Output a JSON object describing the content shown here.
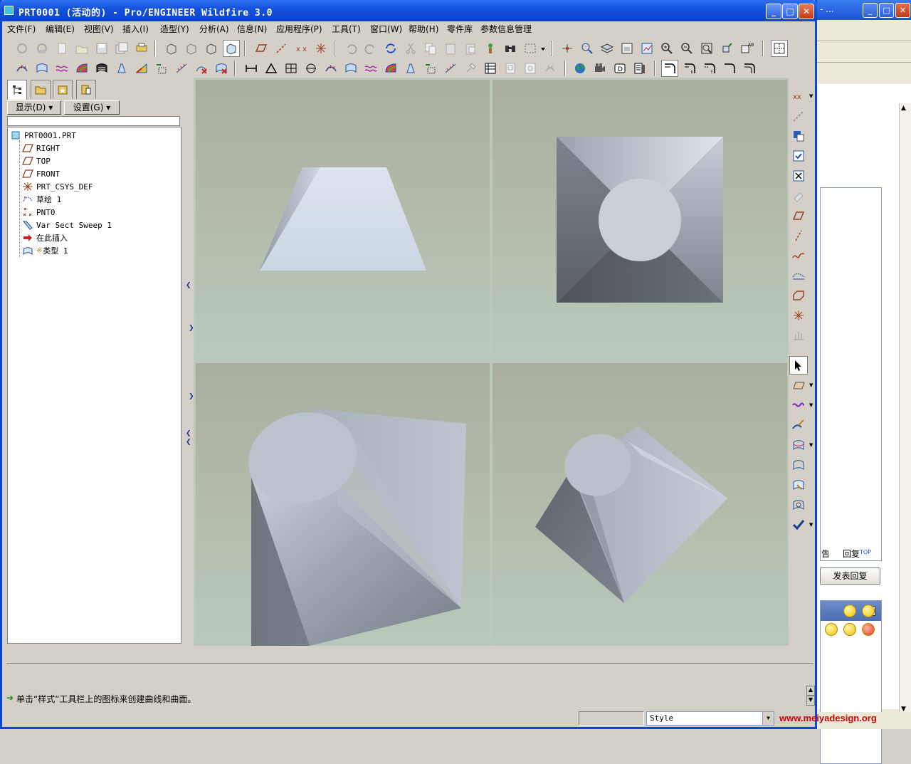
{
  "window": {
    "title": "PRT0001 (活动的) - Pro/ENGINEER Wildfire 3.0",
    "minimize": "_",
    "maximize": "□",
    "close": "✕"
  },
  "menubar": [
    "文件(F)",
    "编辑(E)",
    "视图(V)",
    "插入(I)",
    "造型(Y)",
    "分析(A)",
    "信息(N)",
    "应用程序(P)",
    "工具(T)",
    "窗口(W)",
    "帮助(H)",
    "零件库",
    "参数信息管理"
  ],
  "navigator": {
    "show_label": "显示(D)",
    "settings_label": "设置(G)"
  },
  "model_tree": {
    "root": "PRT0001.PRT",
    "items": [
      {
        "label": "RIGHT",
        "icon": "datum-plane-icon"
      },
      {
        "label": "TOP",
        "icon": "datum-plane-icon"
      },
      {
        "label": "FRONT",
        "icon": "datum-plane-icon"
      },
      {
        "label": "PRT_CSYS_DEF",
        "icon": "csys-icon"
      },
      {
        "label": "草绘 1",
        "icon": "sketch-icon"
      },
      {
        "label": "PNT0",
        "icon": "datum-point-icon"
      },
      {
        "label": "Var Sect Sweep 1",
        "icon": "var-sect-sweep-icon"
      },
      {
        "label": "在此插入",
        "icon": "insert-here-arrow-icon"
      },
      {
        "label": "类型 1",
        "icon": "style-feature-icon"
      }
    ]
  },
  "message": {
    "text": "单击“样式”工具栏上的图标来创建曲线和曲面。"
  },
  "status": {
    "style_select_value": "Style"
  },
  "background_window": {
    "report_label": "告",
    "reply_label": "回复",
    "top_label": "TOP",
    "post_reply_button": "发表回复"
  },
  "watermark": "www.meiyadesign.org",
  "colors": {
    "title_blue": "#0d43c8",
    "model_light": "#d2dbe6",
    "model_dark": "#6a7078",
    "viewport_top": "#a8ada0",
    "viewport_bottom": "#b7c9bc"
  }
}
